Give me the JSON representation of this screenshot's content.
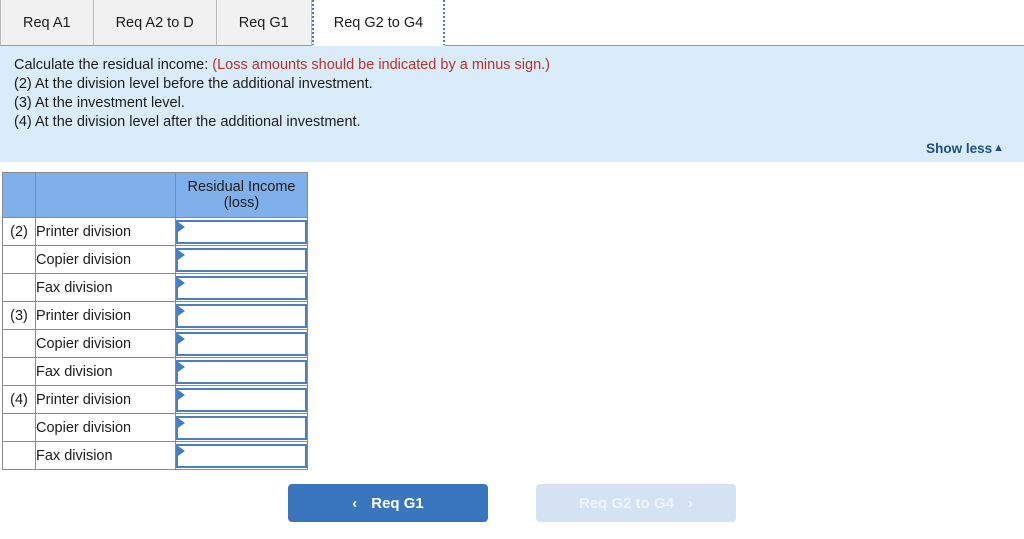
{
  "tabs": [
    {
      "label": "Req A1",
      "active": false
    },
    {
      "label": "Req A2 to D",
      "active": false
    },
    {
      "label": "Req G1",
      "active": false
    },
    {
      "label": "Req G2 to G4",
      "active": true
    }
  ],
  "instructions": {
    "line1_main": "Calculate the residual income:",
    "line1_note": "(Loss amounts should be indicated by a minus sign.)",
    "line2": "(2) At the division level before the additional investment.",
    "line3": "(3) At the investment level.",
    "line4": "(4) At the division level after the additional investment.",
    "show_less_label": "Show less",
    "show_less_caret": "▲"
  },
  "table": {
    "headers": [
      "",
      "",
      "Residual Income (loss)"
    ],
    "header_value_line1": "Residual Income",
    "header_value_line2": "(loss)",
    "rows": [
      {
        "num": "(2)",
        "label": "Printer division",
        "value": ""
      },
      {
        "num": "",
        "label": "Copier division",
        "value": ""
      },
      {
        "num": "",
        "label": "Fax division",
        "value": ""
      },
      {
        "num": "(3)",
        "label": "Printer division",
        "value": ""
      },
      {
        "num": "",
        "label": "Copier division",
        "value": ""
      },
      {
        "num": "",
        "label": "Fax division",
        "value": ""
      },
      {
        "num": "(4)",
        "label": "Printer division",
        "value": ""
      },
      {
        "num": "",
        "label": "Copier division",
        "value": ""
      },
      {
        "num": "",
        "label": "Fax division",
        "value": ""
      }
    ]
  },
  "footer": {
    "prev_label": "Req G1",
    "prev_chevron": "‹",
    "next_label": "Req G2 to G4",
    "next_chevron": "›"
  },
  "colors": {
    "panel_bg": "#daebfa",
    "note_red": "#bd3127",
    "header_blue": "#7fb0ea",
    "primary_button": "#3a76bd",
    "disabled_button": "#d5e2f3",
    "link_navy": "#1f4e8c",
    "input_border": "#4a7fc0"
  }
}
